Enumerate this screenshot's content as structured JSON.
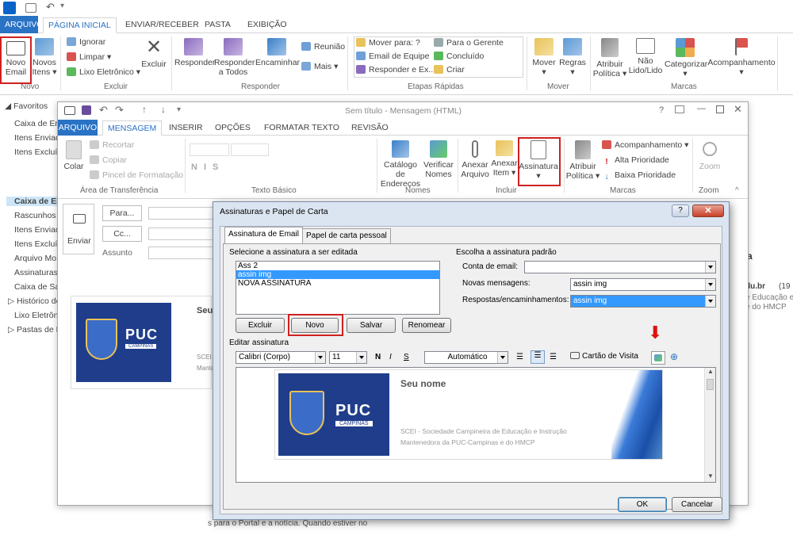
{
  "main": {
    "tabs": [
      "ARQUIVO",
      "PÁGINA INICIAL",
      "ENVIAR/RECEBER",
      "PASTA",
      "EXIBIÇÃO"
    ],
    "novo": {
      "novo_email": [
        "Novo",
        "Email"
      ],
      "novos_itens": [
        "Novos",
        "Itens ▾"
      ],
      "group": "Novo"
    },
    "excluir": {
      "ignorar": "Ignorar",
      "limpar": "Limpar ▾",
      "lixo": "Lixo Eletrônico ▾",
      "excluir": "Excluir",
      "group": "Excluir"
    },
    "responder": {
      "responder": "Responder",
      "responder_todos": [
        "Responder",
        "a Todos"
      ],
      "encaminhar": "Encaminhar",
      "reuniao": "Reunião",
      "mais": "Mais ▾",
      "group": "Responder"
    },
    "etapas": {
      "items": [
        "Mover para: ?",
        "Email de Equipe",
        "Responder e Ex...",
        "Para o Gerente",
        "Concluído",
        "Criar"
      ],
      "group": "Etapas Rápidas"
    },
    "mover": {
      "mover": [
        "Mover",
        "▾"
      ],
      "regras": [
        "Regras",
        "▾"
      ],
      "group": "Mover"
    },
    "marcas": {
      "atribuir": [
        "Atribuir",
        "Política ▾"
      ],
      "nao_lido": [
        "Não",
        "Lido/Lido"
      ],
      "categorizar": [
        "Categorizar",
        "▾"
      ],
      "acompanhamento": [
        "Acompanhamento",
        "▾"
      ],
      "group": "Marcas"
    },
    "nav": {
      "favoritos": "Favoritos",
      "items": [
        "Caixa de Ent",
        "Itens Enviad",
        "Itens Excluí",
        "Caixa de Ent",
        "Rascunhos [",
        "Itens Enviad",
        "Itens Excluí",
        "Arquivo Mo",
        "Assinaturas",
        "Caixa de Saí",
        "Histórico de",
        "Lixo Eletrôni",
        "Pastas de Pe"
      ]
    },
    "right": {
      "a": "a",
      "du": "du.br",
      "p19": "(19",
      "educacao": "e Educação e",
      "hmcp": "e do HMCP"
    },
    "bottom_text": "s para o Portal e a notícia. Quando estiver no"
  },
  "message": {
    "title": "Sem título - Mensagem (HTML)",
    "tabs": [
      "ARQUIVO",
      "MENSAGEM",
      "INSERIR",
      "OPÇÕES",
      "FORMATAR TEXTO",
      "REVISÃO"
    ],
    "clipboard": {
      "colar": "Colar",
      "recortar": "Recortar",
      "copiar": "Copiar",
      "pincel": "Pincel de Formatação",
      "group": "Área de Transferência"
    },
    "texto": {
      "group": "Texto Básico",
      "bold": "N",
      "italic": "I",
      "underline": "S"
    },
    "nomes": {
      "catalogo": [
        "Catálogo de",
        "Endereços"
      ],
      "verificar": [
        "Verificar",
        "Nomes"
      ],
      "group": "Nomes"
    },
    "incluir": {
      "anexar_arquivo": [
        "Anexar",
        "Arquivo"
      ],
      "anexar_item": [
        "Anexar",
        "Item ▾"
      ],
      "assinatura": [
        "Assinatura",
        "▾"
      ],
      "group": "Incluir"
    },
    "marcas": {
      "atribuir": [
        "Atribuir",
        "Política ▾"
      ],
      "acompanhamento": "Acompanhamento ▾",
      "alta": "Alta Prioridade",
      "baixa": "Baixa Prioridade",
      "group": "Marcas"
    },
    "zoom": {
      "label": "Zoom",
      "group": "Zoom"
    },
    "compose": {
      "enviar": "Enviar",
      "para": "Para...",
      "cc": "Cc...",
      "assunto": "Assunto"
    },
    "body": {
      "seu": "Seu",
      "scei": "SCEI",
      "mante": "Mante"
    }
  },
  "dialog": {
    "title": "Assinaturas e Papel de Carta",
    "help": "?",
    "tabs": [
      "Assinatura de Email",
      "Papel de carta pessoal"
    ],
    "select_label": "Selecione a assinatura a ser editada",
    "signatures": [
      "Ass 2",
      "assin img",
      "NOVA ASSINATURA"
    ],
    "buttons": {
      "excluir": "Excluir",
      "novo": "Novo",
      "salvar": "Salvar",
      "renomear": "Renomear"
    },
    "default_label": "Escolha a assinatura padrão",
    "conta": "Conta de email:",
    "novas": "Novas mensagens:",
    "novas_value": "assin img",
    "respostas": "Respostas/encaminhamentos:",
    "respostas_value": "assin img",
    "editar_label": "Editar assinatura",
    "font": "Calibri (Corpo)",
    "size": "11",
    "color": "Automático",
    "cartao": "Cartão de Visita",
    "preview": {
      "name": "Seu nome",
      "line1": "SCEI - Sociedade Campineira de Educação e Instrução",
      "line2": "Mantenedora da PUC-Campinas e do HMCP"
    },
    "logo": {
      "puc": "PUC",
      "campinas": "CAMPINAS"
    },
    "ok": "OK",
    "cancelar": "Cancelar"
  }
}
